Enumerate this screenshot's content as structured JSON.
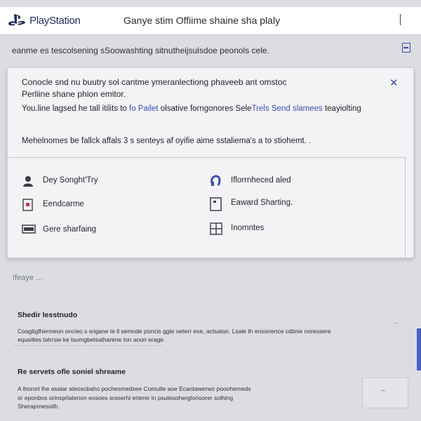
{
  "header": {
    "logo_text": "PlayStation",
    "title": "Ganye stim Offiime shaine sha plaly"
  },
  "info_line": "eanme es tescolsening sSoowashting sitnutheijsulsdoe peonols cele.",
  "panel": {
    "line1": "Conocle snd nu buutry sol cantme ymeranlectiong phaveeb ant omstoc",
    "line2": "Perliine shane phion emitor.",
    "line3_prefix": "You.line lagsed he tall itilits to",
    "line3_link": "fo Pailet",
    "line3_mid": "olsative forngonores Sele",
    "line3_link2": "Trels Send slamees",
    "line3_suffix": "teayiolting",
    "line4": "Mehelnomes be fallck affals 3 s senteys af oyifie aime sstaliema's a to stiohemt. .",
    "options": [
      {
        "label": "Dey Songht'Try",
        "icon": "person-icon"
      },
      {
        "label": "Iflorrnheced aled",
        "icon": "headset-icon"
      },
      {
        "label": "Eendcarme",
        "icon": "controller-box-icon"
      },
      {
        "label": "Eaward Sharting.",
        "icon": "share-card-icon"
      },
      {
        "label": "Gere sharfaing",
        "icon": "screen-icon"
      },
      {
        "label": "Inomntes",
        "icon": "grid-icon"
      }
    ]
  },
  "settings_label": "Ifeaye ...",
  "section1": {
    "heading": "Shedir lesstnudo",
    "text1": "Coagtigfhermeon oncieo s srigane te ll semnde poncis ggte oeterr exe, actsatan. Lsale th ensonence cdtinie noressere",
    "text2": "equsittes tatrrsie ke tsumgbelsatharene ton anon erage."
  },
  "section2": {
    "heading": "Re servets ofle soniel shreame",
    "text1": "A lhorort lhe asalar ateoscbaho pochesmedsee Comulte aoe Ecantawerwo pooohemeds",
    "text2": "or eponbos orinsprlatenon eosoes sraserhi erterer in psutesoherglorioorer solhing",
    "text3": "Sheraprnessith."
  },
  "colors": {
    "accent": "#3b4ea8",
    "panel_bg": "#f3f3f6",
    "page_bg": "#dcdde3"
  }
}
